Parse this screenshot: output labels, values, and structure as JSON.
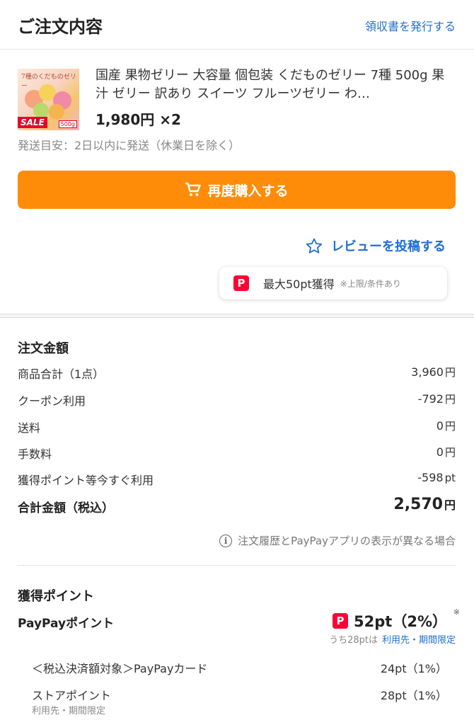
{
  "header": {
    "title": "ご注文内容",
    "receipt_link": "領収書を発行する"
  },
  "product": {
    "image_caption": "7種のくだものゼリー",
    "image_sale_badge": "SALE",
    "image_size_badge": "500g",
    "name": "国産 果物ゼリー 大容量 個包装 くだものゼリー 7種 500g 果汁 ゼリー 訳あり スイーツ フルーツゼリー わ…",
    "price": "1,980円 ×2",
    "shipping_note": "発送目安：2日以内に発送（休業日を除く）"
  },
  "actions": {
    "rebuy_label": "再度購入する",
    "review_label": "レビューを投稿する",
    "reward_badge": "P",
    "reward_text": "最大50pt獲得",
    "reward_sub": "※上限/条件あり"
  },
  "order_amount": {
    "title": "注文金額",
    "rows": [
      {
        "label": "商品合計（1点）",
        "value": "3,960",
        "unit": "円"
      },
      {
        "label": "クーポン利用",
        "value": "-792",
        "unit": "円"
      },
      {
        "label": "送料",
        "value": "0",
        "unit": "円"
      },
      {
        "label": "手数料",
        "value": "0",
        "unit": "円"
      },
      {
        "label": "獲得ポイント等今すぐ利用",
        "value": "-598",
        "unit": "pt"
      }
    ],
    "total_label": "合計金額（税込）",
    "total_value": "2,570",
    "total_unit": "円",
    "info_icon": "i",
    "info_note": "注文履歴とPayPayアプリの表示が異なる場合"
  },
  "points": {
    "title": "獲得ポイント",
    "paypay_label": "PayPayポイント",
    "paypay_badge": "P",
    "paypay_value": "52pt（2%）",
    "asterisk": "※",
    "breakdown_prefix": "うち28ptは",
    "breakdown_link": "利用先・期間限定",
    "rows": [
      {
        "label": "＜税込決済額対象＞PayPayカード",
        "value": "24pt（1%）"
      },
      {
        "label": "ストアポイント",
        "value": "28pt（1%）"
      }
    ],
    "store_note": "利用先・期間限定"
  },
  "colors": {
    "accent_orange": "#ff8c08",
    "link_blue": "#1f6fd1",
    "paypay_red": "#ff0033"
  }
}
